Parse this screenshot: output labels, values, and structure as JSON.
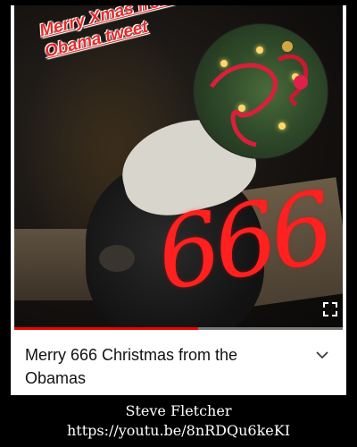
{
  "overlay": {
    "tweet_line1": "Merry Xmas from",
    "tweet_line2": "Obama tweet",
    "number": "666"
  },
  "player": {
    "progress_fraction": 0.56,
    "fullscreen_icon": "fullscreen-icon"
  },
  "video": {
    "title": "Merry 666 Christmas from the Obamas",
    "expand_icon": "chevron-down-icon"
  },
  "credit": {
    "name": "Steve Fletcher",
    "url": "https://youtu.be/8nRDQu6keKI"
  },
  "colors": {
    "accent_red": "#e52a2a",
    "progress_red": "#ee0000",
    "background": "#000000"
  }
}
